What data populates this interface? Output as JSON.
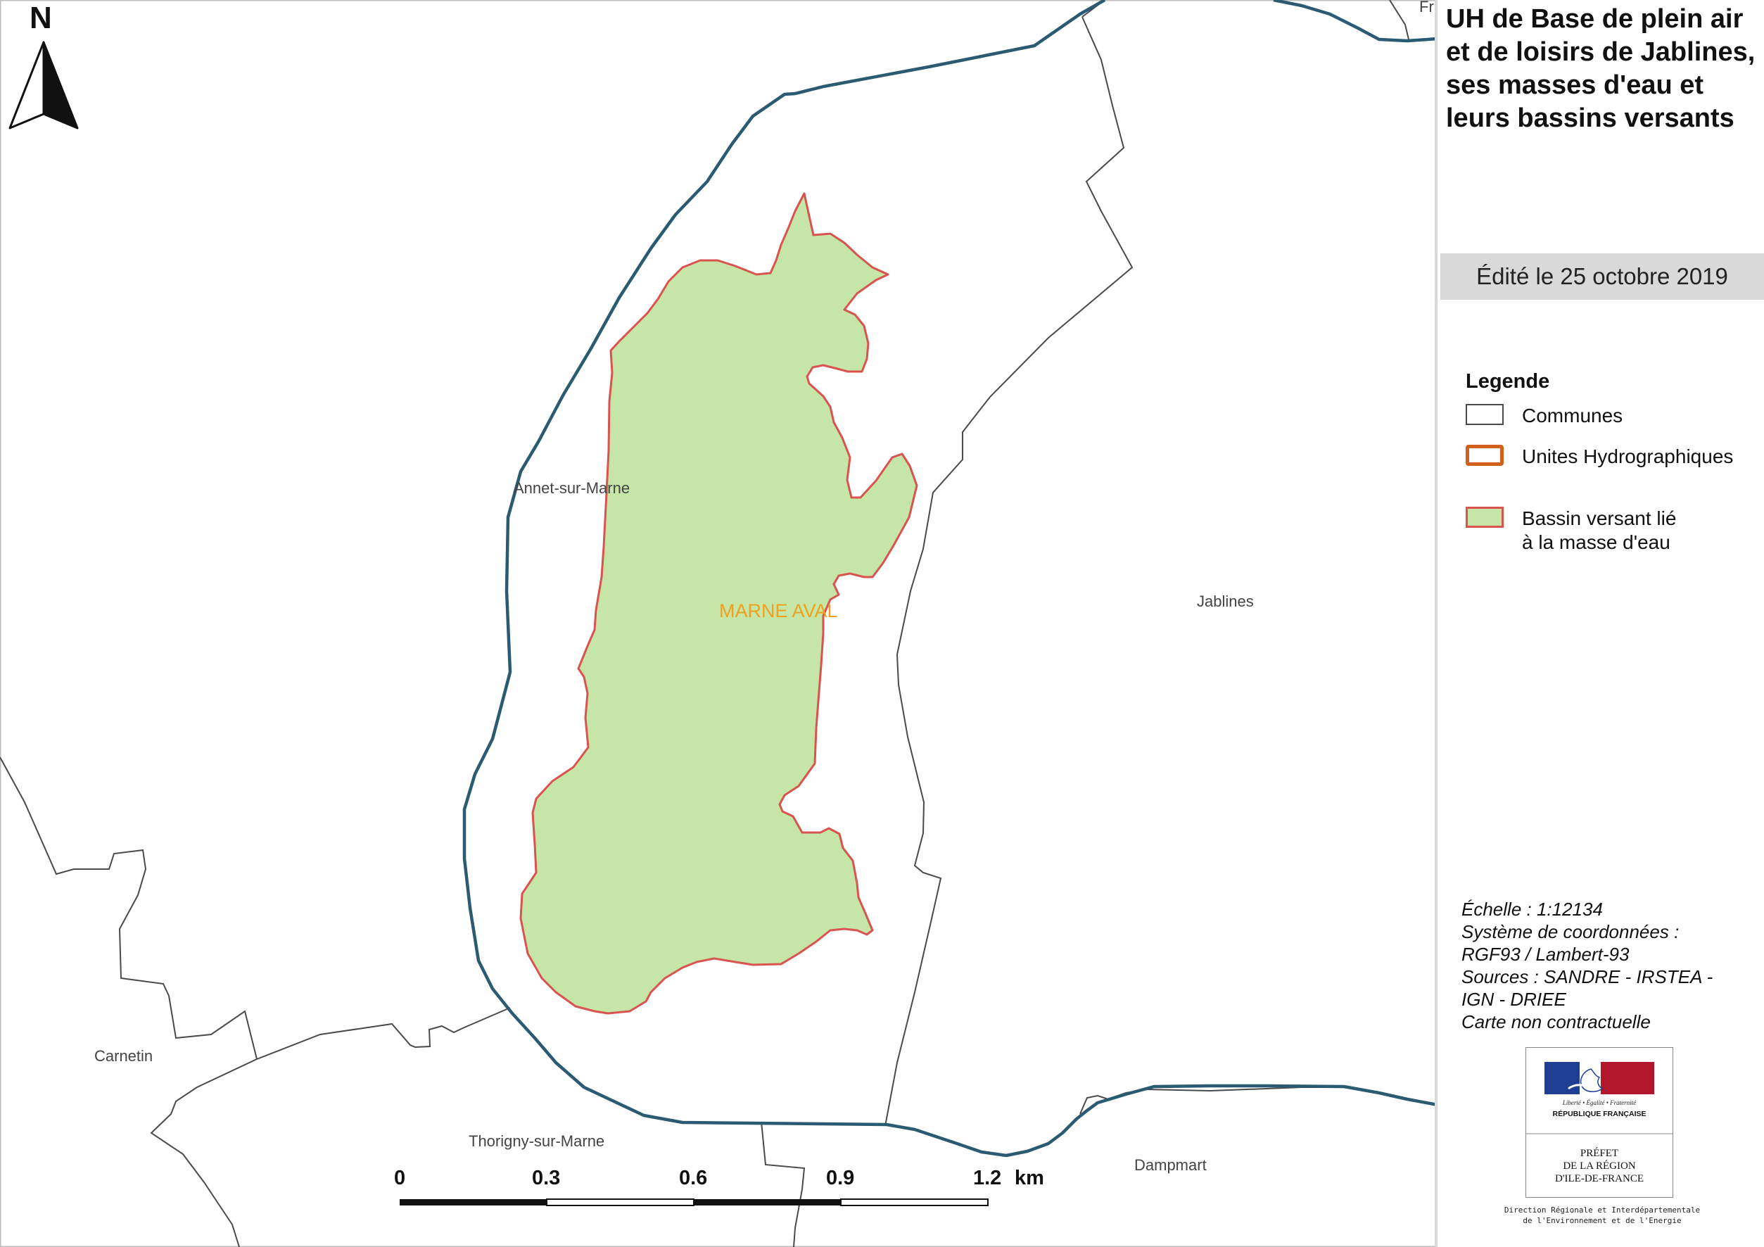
{
  "map": {
    "north_label": "N",
    "communes": [
      "Annet-sur-Marne",
      "Jablines",
      "Carnetin",
      "Thorigny-sur-Marne",
      "Dampmart",
      "Fr"
    ],
    "unit_label": "MARNE AVAL",
    "scale_bar": {
      "ticks": [
        "0",
        "0.3",
        "0.6",
        "0.9",
        "1.2"
      ],
      "unit": "km"
    },
    "colors": {
      "commune_border": "#4a4a4a",
      "uh_border": "#2b5a73",
      "bassin_fill": "#c5e6a6",
      "bassin_border": "#d9534f",
      "uh_label": "#f0a020"
    }
  },
  "panel": {
    "title": "UH de Base de plein air et de loisirs de Jablines, ses masses d'eau et leurs bassins versants",
    "edit_date": "Édité le 25 octobre 2019",
    "legend": {
      "title": "Legende",
      "items": [
        {
          "label": "Communes",
          "swatch": "commune"
        },
        {
          "label": "Unites Hydrographiques",
          "swatch": "uh"
        },
        {
          "label": "Bassin versant lié",
          "label2": "à la masse d'eau",
          "swatch": "bassin"
        }
      ],
      "colors": {
        "uh_swatch_border": "#d2601a"
      }
    },
    "meta": {
      "scale": "Échelle :  1:12134",
      "crs_label": "Système de coordonnées :",
      "crs": "RGF93 / Lambert-93",
      "sources": "Sources : SANDRE - IRSTEA -",
      "sources2": "IGN - DRIEE",
      "disclaimer": "Carte non contractuelle"
    },
    "logo": {
      "motto": "Liberté • Égalité • Fraternité",
      "republic": "RÉPUBLIQUE FRANÇAISE",
      "prefet_line1": "PRÉFET",
      "prefet_line2": "DE LA RÉGION",
      "prefet_line3": "D'ILE-DE-FRANCE",
      "direction_line1": "Direction Régionale et Interdépartementale",
      "direction_line2": "de l'Environnement et de l'Energie",
      "colors": {
        "blue": "#1e3f93",
        "red": "#b2162b"
      }
    }
  }
}
